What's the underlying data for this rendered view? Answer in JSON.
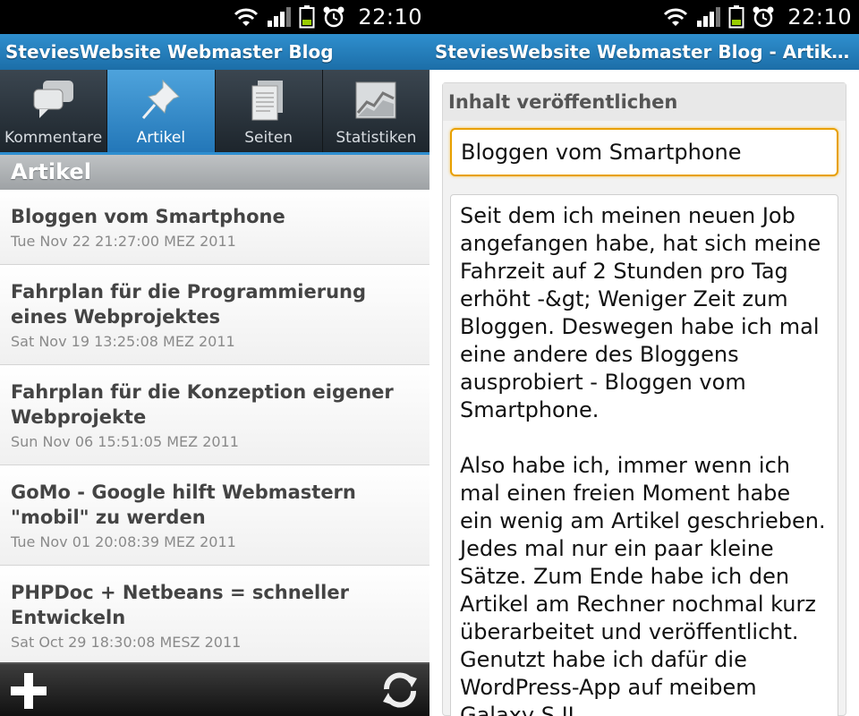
{
  "status_bar": {
    "time": "22:10"
  },
  "left": {
    "title": "SteviesWebsite Webmaster Blog",
    "tabs": [
      {
        "label": "Kommentare",
        "icon": "comments-icon",
        "active": false
      },
      {
        "label": "Artikel",
        "icon": "pushpin-icon",
        "active": true
      },
      {
        "label": "Seiten",
        "icon": "pages-icon",
        "active": false
      },
      {
        "label": "Statistiken",
        "icon": "stats-chart-icon",
        "active": false
      }
    ],
    "section_header": "Artikel",
    "posts": [
      {
        "title": "Bloggen vom Smartphone",
        "date": "Tue Nov 22 21:27:00 MEZ 2011"
      },
      {
        "title": "Fahrplan für die Programmierung eines Webprojektes",
        "date": "Sat Nov 19 13:25:08 MEZ 2011"
      },
      {
        "title": "Fahrplan für die Konzeption eigener Webprojekte",
        "date": "Sun Nov 06 15:51:05 MEZ 2011"
      },
      {
        "title": "GoMo - Google hilft Webmastern \"mobil\" zu werden",
        "date": "Tue Nov 01 20:08:39 MEZ 2011"
      },
      {
        "title": "PHPDoc + Netbeans = schneller Entwickeln",
        "date": "Sat Oct 29 18:30:08 MESZ 2011"
      }
    ]
  },
  "right": {
    "title": "SteviesWebsite Webmaster Blog - Artikel bea...",
    "panel_heading": "Inhalt veröffentlichen",
    "post_title_value": "Bloggen vom Smartphone",
    "content": "Seit dem ich meinen neuen Job angefangen habe, hat sich meine Fahrzeit auf 2 Stunden pro Tag erhöht -&gt; Weniger Zeit zum Bloggen. Deswegen habe ich mal eine andere des Bloggens ausprobiert - Bloggen vom Smartphone.\n\nAlso habe ich, immer wenn ich mal einen freien Moment habe ein wenig am Artikel geschrieben. Jedes mal nur ein paar kleine Sätze. Zum Ende habe ich den Artikel am Rechner nochmal kurz überarbeitet und veröffentlicht. Genutzt habe ich dafür die WordPress-App auf meibem Galaxy S II."
  }
}
